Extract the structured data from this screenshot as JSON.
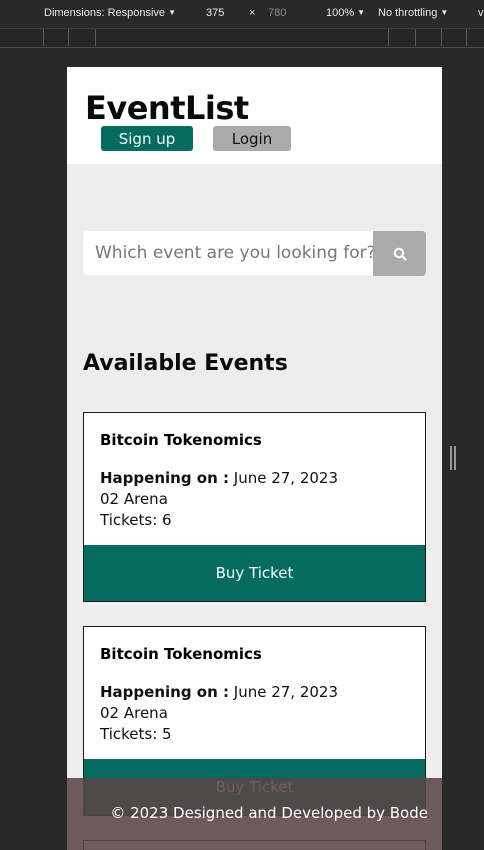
{
  "devtools": {
    "dimensions_label": "Dimensions: Responsive",
    "width": "375",
    "times": "×",
    "height": "780",
    "zoom": "100%",
    "throttling": "No throttling",
    "more": "v"
  },
  "header": {
    "brand": "EventList",
    "signup_label": "Sign up",
    "login_label": "Login"
  },
  "search": {
    "placeholder": "Which event are you looking for?",
    "icon": "search-icon"
  },
  "section_title": "Available Events",
  "events": [
    {
      "title": "Bitcoin Tokenomics",
      "date_label": "Happening on :",
      "date": "June 27, 2023",
      "venue": "02 Arena",
      "tickets": "Tickets: 6",
      "buy_label": "Buy Ticket"
    },
    {
      "title": "Bitcoin Tokenomics",
      "date_label": "Happening on :",
      "date": "June 27, 2023",
      "venue": "02 Arena",
      "tickets": "Tickets: 5",
      "buy_label": "Buy Ticket"
    }
  ],
  "footer": {
    "text": "© 2023 Designed and Developed by Bode"
  },
  "colors": {
    "primary": "#046b5e",
    "secondary": "#aaaaaa",
    "background": "#ededed"
  }
}
